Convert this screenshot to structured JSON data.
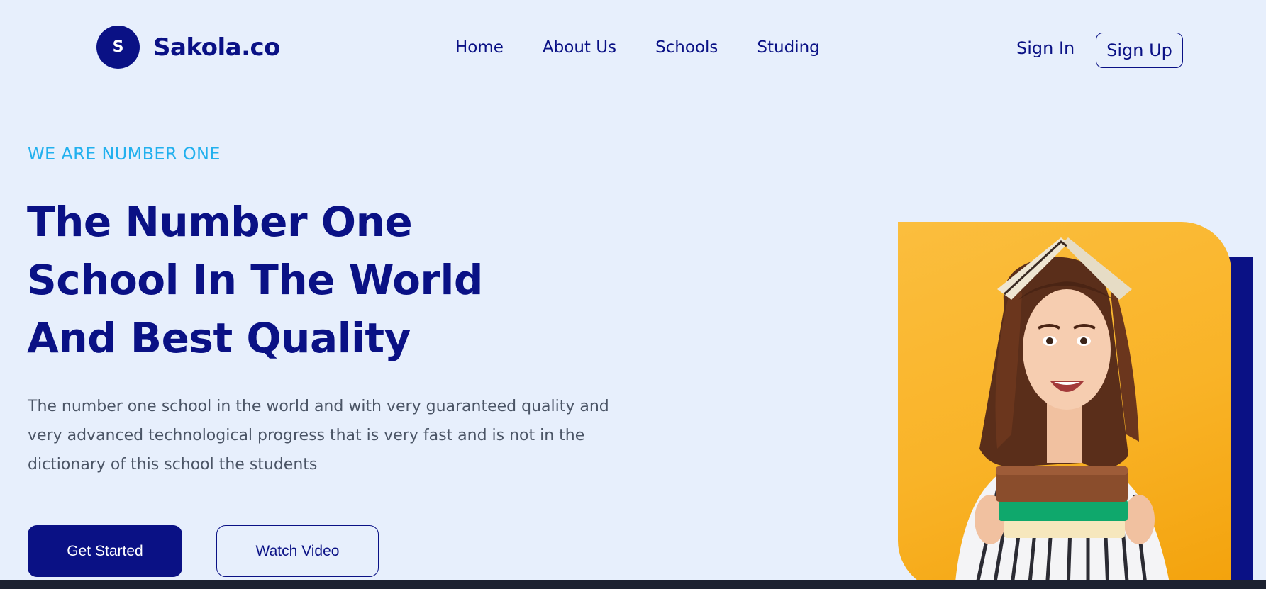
{
  "header": {
    "logo_letter": "S",
    "logo_text": "Sakola.co",
    "nav": [
      {
        "label": "Home"
      },
      {
        "label": "About Us"
      },
      {
        "label": "Schools"
      },
      {
        "label": "Studing"
      }
    ],
    "sign_in": "Sign In",
    "sign_up": "Sign Up"
  },
  "hero": {
    "eyebrow": "WE ARE NUMBER ONE",
    "title_lines": [
      "The Number One",
      "School In The World",
      "And Best Quality"
    ],
    "description": "The number one school in the world and with very guaranteed quality and very advanced technological progress that is very fast and is not in the dictionary of this school the students",
    "primary_button": "Get Started",
    "secondary_button": "Watch Video",
    "image_icon": "student-with-books-photo"
  },
  "colors": {
    "brand": "#0a1185",
    "accent": "#22b0ee",
    "background": "#e7effc",
    "photo_bg": "#f9b327"
  }
}
